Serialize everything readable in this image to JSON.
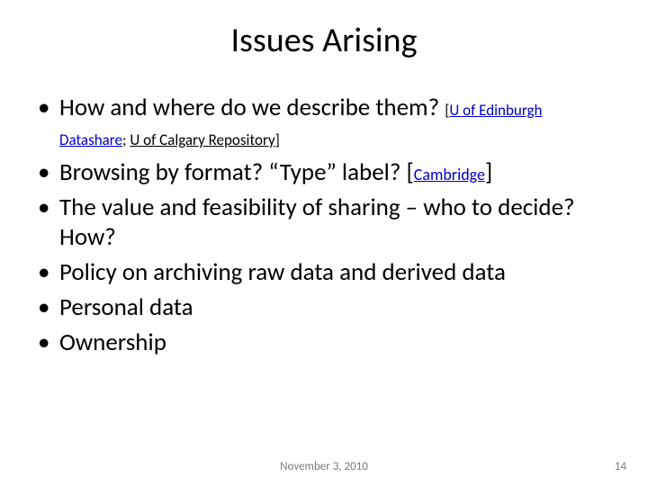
{
  "title": "Issues Arising",
  "bullets": {
    "b1": {
      "text": "How and where do we describe them? ",
      "ref_open": "[",
      "link1": "U of Edinburgh Datashare",
      "sep": ";   ",
      "link2": "U of Calgary Repository",
      "ref_close": "]"
    },
    "b2": {
      "pre": "Browsing by format? “Type” label? [",
      "link": "Cambridge",
      "post": "]"
    },
    "b3": "The value and feasibility of sharing – who to decide? How?",
    "b4": "Policy on archiving raw data and derived data",
    "b5": "Personal data",
    "b6": "Ownership"
  },
  "footer": {
    "date": "November 3, 2010",
    "page": "14"
  }
}
